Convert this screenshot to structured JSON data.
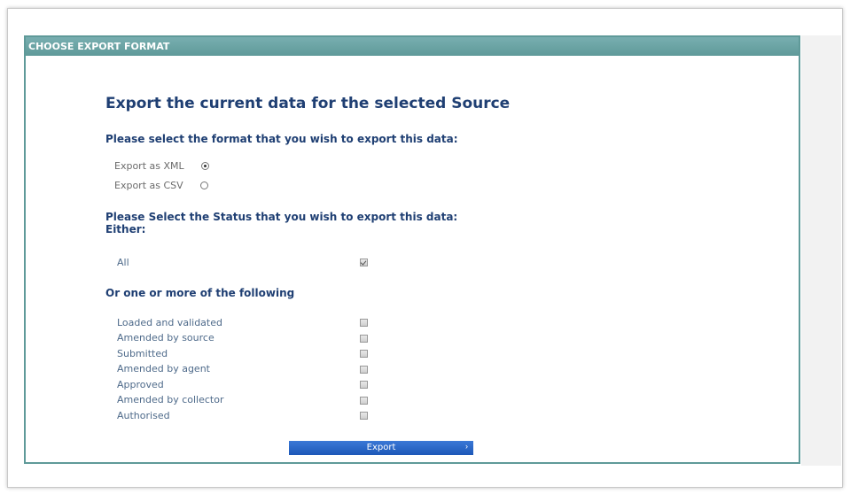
{
  "panel": {
    "title": "CHOOSE EXPORT FORMAT"
  },
  "main": {
    "heading": "Export the current data for the selected Source",
    "format_prompt": "Please select the format that you wish to export this data:",
    "formats": [
      {
        "label": "Export as XML",
        "checked": true
      },
      {
        "label": "Export as CSV",
        "checked": false
      }
    ],
    "status_prompt_line1": "Please Select the Status that you wish to export this data:",
    "status_prompt_line2": "Either:",
    "all_label": "All",
    "all_checked": true,
    "or_prompt": "Or one or more of the following",
    "statuses": [
      {
        "label": "Loaded and validated",
        "checked": false
      },
      {
        "label": "Amended by source",
        "checked": false
      },
      {
        "label": "Submitted",
        "checked": false
      },
      {
        "label": "Amended by agent",
        "checked": false
      },
      {
        "label": "Approved",
        "checked": false
      },
      {
        "label": "Amended by collector",
        "checked": false
      },
      {
        "label": "Authorised",
        "checked": false
      }
    ],
    "export_button_label": "Export",
    "export_button_arrow": "›"
  }
}
